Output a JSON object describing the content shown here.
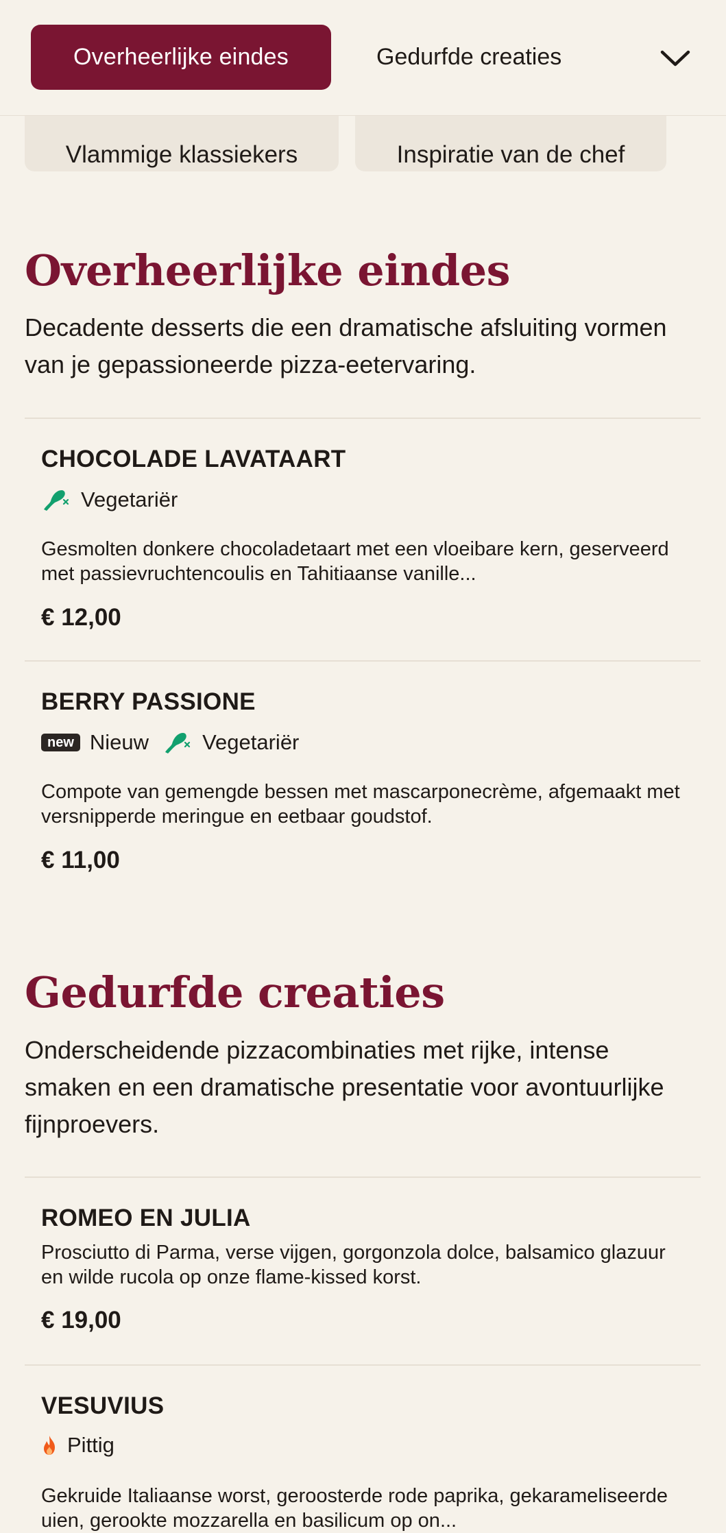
{
  "nav": {
    "active_tab": "Overheerlijke eindes",
    "next_tab": "Gedurfde creaties",
    "expand_icon": "chevron-down-icon",
    "row2": [
      "Vlammige klassiekers",
      "Inspiratie van de chef"
    ]
  },
  "colors": {
    "accent": "#7a1532",
    "background": "#f6f2ea",
    "vegetarian": "#12a06e",
    "spicy": "#f05a1a"
  },
  "sections": [
    {
      "title": "Overheerlijke eindes",
      "description": "Decadente desserts die een dramatische afsluiting vormen van je gepassioneerde pizza-eetervaring.",
      "items": [
        {
          "name": "CHOCOLADE LAVATAART",
          "tag_vegetarian": "Vegetariër",
          "description": "Gesmolten donkere chocoladetaart met een vloeibare kern, geserveerd met passievruchtencoulis en Tahitiaanse vanille...",
          "price": "€ 12,00"
        },
        {
          "name": "BERRY PASSIONE",
          "badge": "new",
          "tag_new": "Nieuw",
          "tag_vegetarian": "Vegetariër",
          "description": "Compote van gemengde bessen met mascarponecrème, afgemaakt met versnipperde meringue en eetbaar goudstof.",
          "price": "€ 11,00"
        }
      ]
    },
    {
      "title": "Gedurfde creaties",
      "description": "Onderscheidende pizzacombinaties met rijke, intense smaken en een dramatische presentatie voor avontuurlijke fijnproevers.",
      "items": [
        {
          "name": "ROMEO EN JULIA",
          "description": "Prosciutto di Parma, verse vijgen, gorgonzola dolce, balsamico glazuur en wilde rucola op onze flame-kissed korst.",
          "price": "€ 19,00"
        },
        {
          "name": "VESUVIUS",
          "tag_spicy": "Pittig",
          "description": "Gekruide Italiaanse worst, geroosterde rode paprika, gekarameliseerde uien, gerookte mozzarella en basilicum op on..."
        }
      ]
    }
  ]
}
